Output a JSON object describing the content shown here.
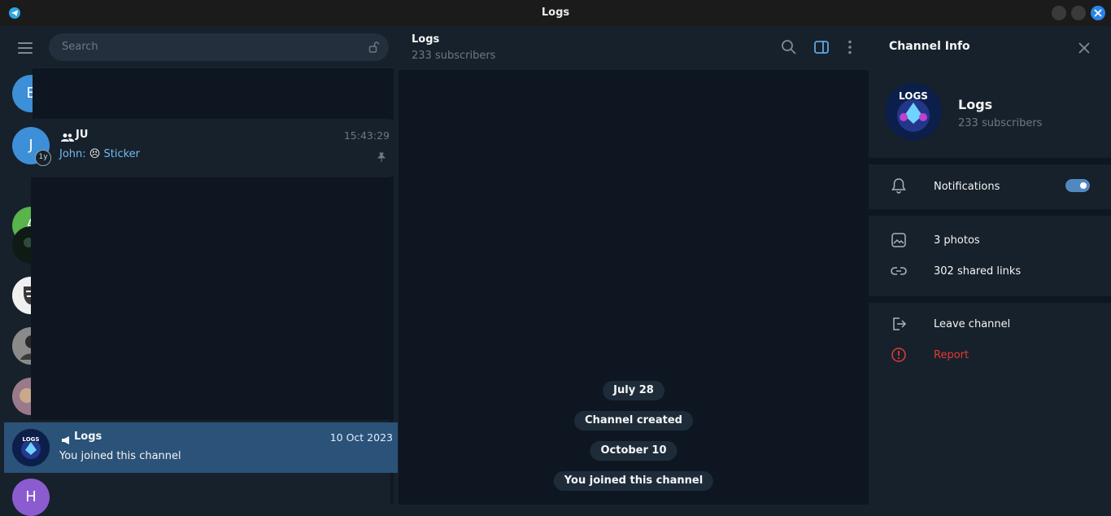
{
  "window": {
    "title": "Logs"
  },
  "search": {
    "placeholder": "Search"
  },
  "chats": {
    "ju": {
      "name": "JU",
      "time": "15:43:29",
      "sender": "John:",
      "emoji": "😣",
      "preview": "Sticker",
      "badge": "1y"
    },
    "logs": {
      "name": "Logs",
      "date": "10 Oct 2023",
      "preview": "You joined this channel"
    },
    "avatars": [
      {
        "letter": "E",
        "color": "#3d8fd8"
      },
      {
        "letter": "J",
        "color": "#3d8fd8"
      },
      {
        "letter": "A",
        "color": "#58b44b"
      },
      {
        "letter": "H",
        "color": "#8b5ccf"
      }
    ]
  },
  "chat_header": {
    "title": "Logs",
    "subtitle": "233 subscribers"
  },
  "service_messages": [
    "July 28",
    "Channel created",
    "October 10",
    "You joined this channel"
  ],
  "channel_info": {
    "title": "Channel Info",
    "name": "Logs",
    "subscribers": "233 subscribers",
    "avatar_text": "LOGS",
    "notifications_label": "Notifications",
    "notifications_on": true,
    "photos": "3 photos",
    "links": "302 shared links",
    "leave": "Leave channel",
    "report": "Report"
  },
  "colors": {
    "accent": "#5288c1",
    "selected": "#2b5278",
    "danger": "#e53935"
  }
}
